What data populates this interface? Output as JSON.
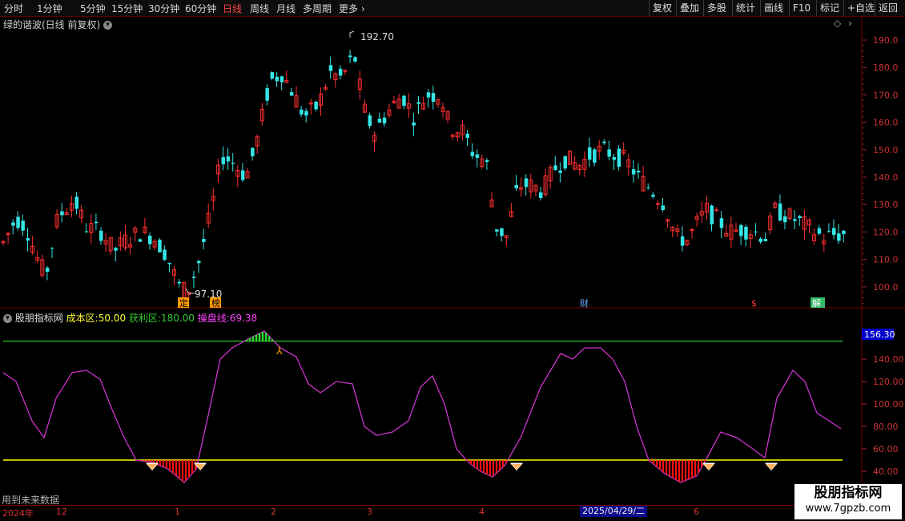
{
  "toolbar": {
    "periods": [
      "分时",
      "1分钟",
      "5分钟",
      "15分钟",
      "30分钟",
      "60分钟",
      "日线",
      "周线",
      "月线",
      "多周期",
      "更多"
    ],
    "active_period": "日线",
    "right_buttons": [
      "复权",
      "叠加",
      "多股",
      "统计",
      "画线",
      "F10",
      "标记",
      "+自选",
      "返回"
    ]
  },
  "main_chart": {
    "title": "绿的谐波(日线 前复权)",
    "price_axis": [
      "190.0",
      "180.0",
      "170.0",
      "160.0",
      "150.0",
      "140.0",
      "130.0",
      "120.0",
      "110.0",
      "100.0"
    ],
    "high_label": "192.70",
    "low_label": "97.10",
    "event_markers": [
      "定",
      "榜",
      "财",
      "$",
      "解"
    ],
    "colors": {
      "up": "#ff3030",
      "down": "#34e5e5"
    }
  },
  "indicator": {
    "name": "股朋指标网",
    "params": [
      {
        "label": "成本区:",
        "value": "50.00",
        "color": "#ffff33"
      },
      {
        "label": "获利区:",
        "value": "180.00",
        "color": "#33cc33"
      },
      {
        "label": "操盘线:",
        "value": "69.38",
        "color": "#ff44ff"
      }
    ],
    "current_value": "156.30",
    "axis": [
      "140.00",
      "120.00",
      "100.00",
      "80.00",
      "60.00",
      "40.00"
    ],
    "colors": {
      "line": "#cc33cc",
      "upper": "#22aa22",
      "lower": "#ffff00",
      "fill": "#ff1010"
    }
  },
  "footer": {
    "note": "用到未来数据",
    "date_labels": [
      "2024年",
      "12",
      "1",
      "2",
      "3",
      "4",
      "2025/04/29/二",
      "6"
    ]
  },
  "watermark": {
    "line1": "股朋指标网",
    "line2": "www.7gpzb.com"
  }
}
